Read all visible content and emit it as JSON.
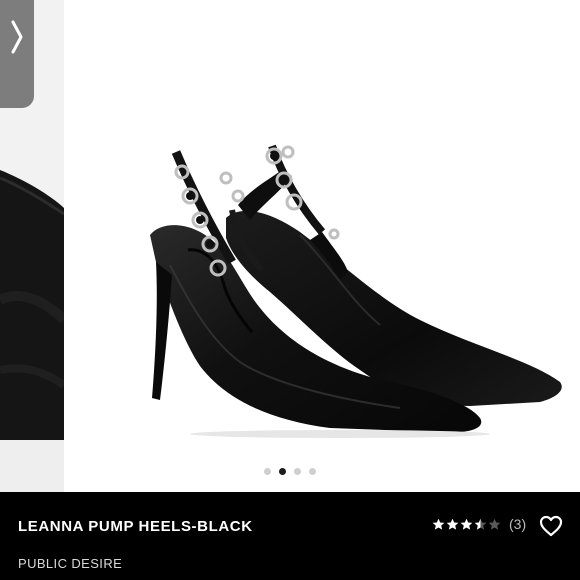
{
  "gallery": {
    "prev_icon": "chevron-right-icon",
    "slide_count": 4,
    "active_slide": 2
  },
  "product": {
    "name": "LEANNA PUMP HEELS-BLACK",
    "brand": "PUBLIC DESIRE",
    "rating": 3.5,
    "rating_max": 5,
    "review_count": "(3)"
  },
  "wishlist": {
    "icon": "heart-outline-icon"
  },
  "colors": {
    "info_bar_bg": "#000000",
    "text": "#ffffff",
    "muted_text": "#bcbcbc",
    "dot_active": "#1b1b1b",
    "dot_inactive": "#cfcfcf",
    "arrow_tab": "#7d7d7d"
  }
}
